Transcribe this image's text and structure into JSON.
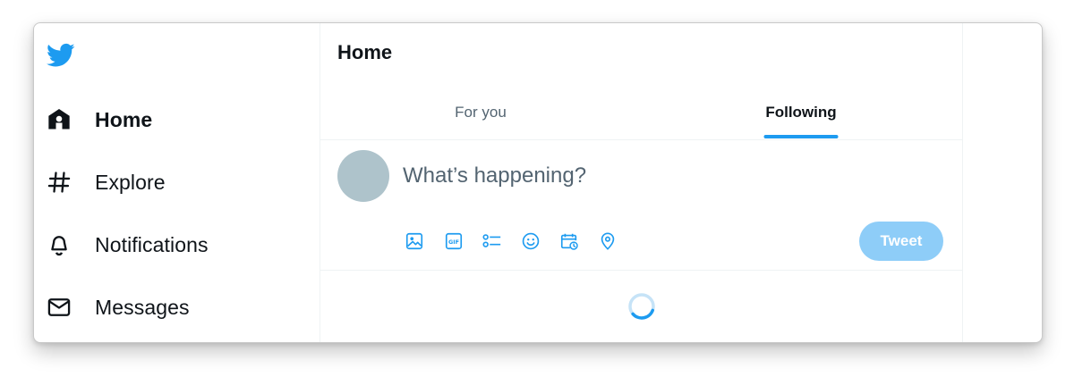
{
  "sidebar": {
    "logo_icon": "twitter-bird-icon",
    "items": [
      {
        "label": "Home",
        "icon": "home-icon",
        "active": true
      },
      {
        "label": "Explore",
        "icon": "hashtag-icon",
        "active": false
      },
      {
        "label": "Notifications",
        "icon": "bell-icon",
        "active": false
      },
      {
        "label": "Messages",
        "icon": "envelope-icon",
        "active": false
      }
    ]
  },
  "main": {
    "title": "Home",
    "tabs": [
      {
        "label": "For you",
        "selected": false
      },
      {
        "label": "Following",
        "selected": true
      }
    ],
    "composer": {
      "placeholder": "What’s happening?",
      "tools": [
        "image-icon",
        "gif-icon",
        "poll-icon",
        "emoji-icon",
        "schedule-icon",
        "location-icon"
      ],
      "tweet_label": "Tweet"
    },
    "loading": true
  },
  "colors": {
    "brand": "#1d9bf0",
    "tweet_button_disabled": "#8ecdf8",
    "avatar": "#aec3cb",
    "text_primary": "#0f1419",
    "text_secondary": "#536471"
  }
}
